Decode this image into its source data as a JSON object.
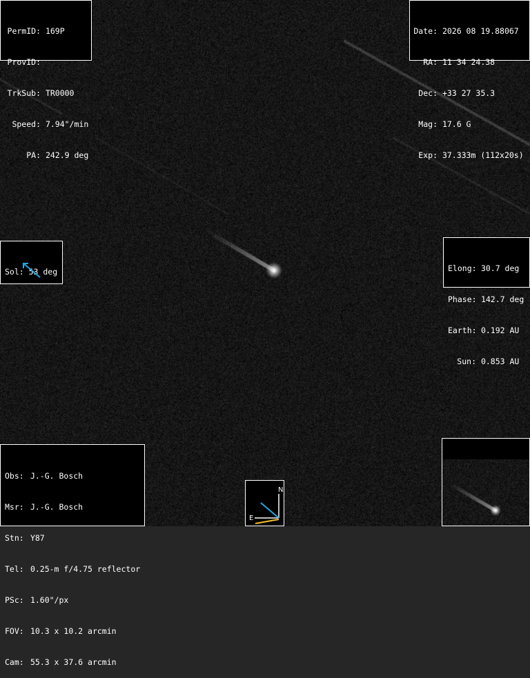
{
  "image": {
    "description": "Comet 169P imaged against a star field with stars trailed as streaks",
    "background_color": "#262626"
  },
  "track_info": {
    "rows": [
      {
        "label": "PermID:",
        "value": "169P"
      },
      {
        "label": "ProvID:",
        "value": ""
      },
      {
        "label": "TrkSub:",
        "value": "TR0000"
      },
      {
        "label": "Speed:",
        "value": "7.94\"/min"
      },
      {
        "label": "PA:",
        "value": "242.9 deg"
      }
    ]
  },
  "position_info": {
    "rows": [
      {
        "label": "Date:",
        "value": "2026 08 19.88067"
      },
      {
        "label": "RA:",
        "value": "11 34 24.38"
      },
      {
        "label": "Dec:",
        "value": "+33 27 35.3"
      },
      {
        "label": "Mag:",
        "value": "17.6 G"
      },
      {
        "label": "Exp:",
        "value": "37.333m (112x20s)"
      }
    ]
  },
  "solar": {
    "text": "Sol: 53 deg",
    "arrow_color": "#29a8e0",
    "arrow_icon": "sun-direction-arrow-icon"
  },
  "geometry_info": {
    "rows": [
      {
        "label": "Elong:",
        "value": "30.7 deg"
      },
      {
        "label": "Phase:",
        "value": "142.7 deg"
      },
      {
        "label": "Earth:",
        "value": "0.192 AU"
      },
      {
        "label": "Sun:",
        "value": "0.853 AU"
      }
    ]
  },
  "observer_info": {
    "rows": [
      {
        "label": "Obs:",
        "value": "J.-G. Bosch"
      },
      {
        "label": "Msr:",
        "value": "J.-G. Bosch"
      },
      {
        "label": "Stn:",
        "value": "Y87"
      },
      {
        "label": "Tel:",
        "value": "0.25-m f/4.75 reflector"
      },
      {
        "label": "PSc:",
        "value": "1.60\"/px"
      },
      {
        "label": "FOV:",
        "value": "10.3 x 10.2 arcmin"
      },
      {
        "label": "Cam:",
        "value": "55.3 x 37.6 arcmin"
      }
    ]
  },
  "compass": {
    "north_label": "N",
    "east_label": "E",
    "north_color": "#ffffff",
    "east_color": "#ffffff",
    "motion_color": "#29a8e0",
    "east_arrow_color": "#f2c230",
    "icon": "compass-rose-icon"
  },
  "thumbnail": {
    "icon": "comet-zoom-thumbnail"
  }
}
